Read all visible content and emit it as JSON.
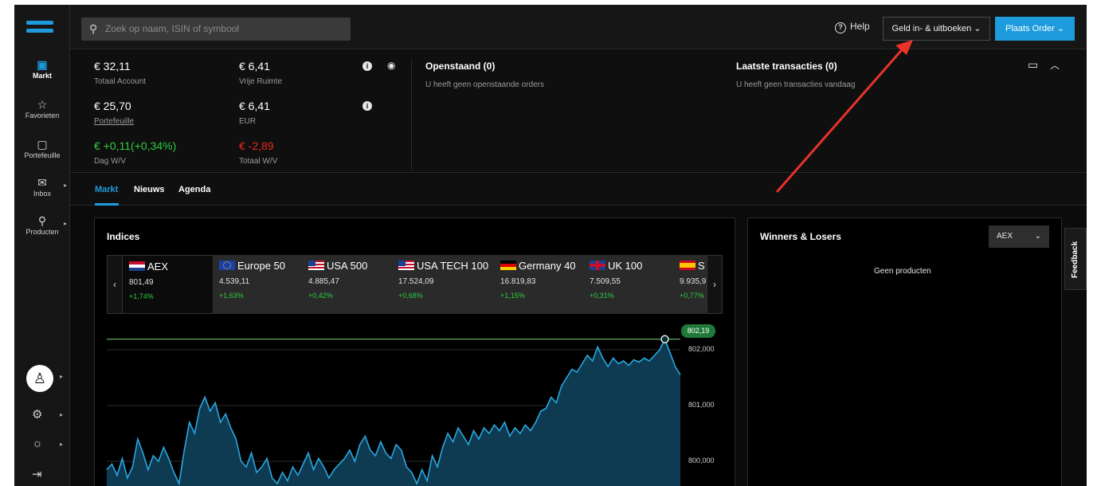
{
  "search": {
    "placeholder": "Zoek op naam, ISIN of symbool"
  },
  "topbar": {
    "help_label": "Help",
    "geld_button_label": "Geld in- & uitboeken ⌄",
    "order_button_label": "Plaats Order ⌄"
  },
  "sidebar": {
    "items": [
      {
        "label": "Markt",
        "icon": "chart-icon"
      },
      {
        "label": "Favorieten",
        "icon": "star-icon"
      },
      {
        "label": "Portefeuille",
        "icon": "wallet-icon"
      },
      {
        "label": "Inbox",
        "icon": "mail-icon"
      },
      {
        "label": "Producten",
        "icon": "products-search-icon"
      }
    ]
  },
  "account": {
    "totaal_account_value": "€ 32,11",
    "totaal_account_label": "Totaal Account",
    "vrije_ruimte_value": "€ 6,41",
    "vrije_ruimte_label": "Vrije Ruimte",
    "portefeuille_value": "€ 25,70",
    "portefeuille_label": "Portefeuille",
    "eur_value": "€ 6,41",
    "eur_label": "EUR",
    "dag_wv_value": "€ +0,11(+0,34%)",
    "dag_wv_label": "Dag W/V",
    "totaal_wv_value": "€ -2,89",
    "totaal_wv_label": "Totaal W/V"
  },
  "openstaand": {
    "title": "Openstaand (0)",
    "text": "U heeft geen openstaande orders"
  },
  "transacties": {
    "title": "Laatste transacties (0)",
    "text": "U heeft geen transacties vandaag"
  },
  "tabs": [
    {
      "label": "Markt"
    },
    {
      "label": "Nieuws"
    },
    {
      "label": "Agenda"
    }
  ],
  "indices": {
    "title": "Indices",
    "items": [
      {
        "name": "AEX",
        "price": "801,49",
        "change": "+1,74%",
        "flag": "nl"
      },
      {
        "name": "Europe 50",
        "price": "4.539,11",
        "change": "+1,63%",
        "flag": "eu"
      },
      {
        "name": "USA 500",
        "price": "4.885,47",
        "change": "+0,42%",
        "flag": "us"
      },
      {
        "name": "USA TECH 100",
        "price": "17.524,09",
        "change": "+0,68%",
        "flag": "us"
      },
      {
        "name": "Germany 40",
        "price": "16.819,83",
        "change": "+1,15%",
        "flag": "de"
      },
      {
        "name": "UK 100",
        "price": "7.509,55",
        "change": "+0,31%",
        "flag": "uk"
      },
      {
        "name": "S",
        "price": "9.935,9",
        "change": "+0,77%",
        "flag": "es"
      }
    ]
  },
  "chart_data": {
    "type": "area",
    "title": "",
    "xlabel": "",
    "ylabel": "",
    "ylim": [
      799.5,
      802.5
    ],
    "yticks": [
      "802,000",
      "801,000",
      "800,000"
    ],
    "ytick_values": [
      802.0,
      801.0,
      800.0
    ],
    "current_label": "802,19",
    "current_value": 802.19,
    "grid": true,
    "colors": {
      "line": "#2aa8e0",
      "fill": "#0e3a52",
      "current_line": "#7fd27f"
    },
    "values": [
      799.85,
      799.95,
      799.75,
      800.05,
      799.7,
      799.9,
      800.4,
      800.15,
      799.85,
      800.1,
      800.0,
      800.25,
      800.05,
      799.8,
      799.6,
      800.2,
      800.7,
      800.5,
      800.95,
      801.15,
      800.9,
      801.05,
      800.7,
      800.85,
      800.6,
      800.4,
      800.0,
      799.9,
      800.15,
      799.8,
      799.9,
      800.05,
      799.7,
      799.6,
      799.8,
      799.65,
      799.9,
      799.75,
      799.95,
      800.15,
      799.85,
      800.05,
      799.9,
      799.7,
      799.85,
      799.95,
      800.05,
      800.2,
      800.0,
      800.3,
      800.45,
      800.2,
      800.1,
      800.35,
      800.15,
      800.05,
      800.3,
      800.2,
      799.9,
      799.8,
      799.6,
      799.85,
      799.65,
      800.1,
      799.9,
      800.25,
      800.5,
      800.35,
      800.6,
      800.45,
      800.3,
      800.55,
      800.4,
      800.6,
      800.5,
      800.65,
      800.55,
      800.7,
      800.45,
      800.6,
      800.5,
      800.65,
      800.55,
      800.7,
      800.9,
      800.95,
      801.15,
      801.05,
      801.35,
      801.5,
      801.65,
      801.6,
      801.75,
      801.9,
      801.8,
      802.05,
      801.85,
      801.7,
      801.85,
      801.75,
      801.8,
      801.72,
      801.82,
      801.78,
      801.85,
      801.8,
      801.9,
      802.0,
      802.19,
      801.95,
      801.7,
      801.55
    ]
  },
  "winners_losers": {
    "title": "Winners & Losers",
    "select_value": "AEX",
    "empty_text": "Geen producten"
  },
  "feedback": {
    "label": "Feedback"
  },
  "annotation": {
    "arrow_color": "#e8322a"
  }
}
